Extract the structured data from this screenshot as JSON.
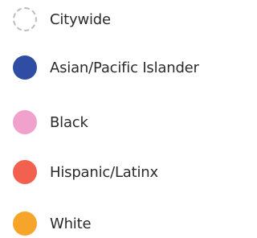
{
  "legend": {
    "items": [
      {
        "label": "Citywide",
        "color": "#bdbdbd",
        "style": "dashed-outline"
      },
      {
        "label": "Asian/Pacific Islander",
        "color": "#2f4da3",
        "style": "filled"
      },
      {
        "label": "Black",
        "color": "#f0a2cc",
        "style": "filled"
      },
      {
        "label": "Hispanic/Latinx",
        "color": "#f2614f",
        "style": "filled"
      },
      {
        "label": "White",
        "color": "#f6a52a",
        "style": "filled"
      }
    ]
  }
}
